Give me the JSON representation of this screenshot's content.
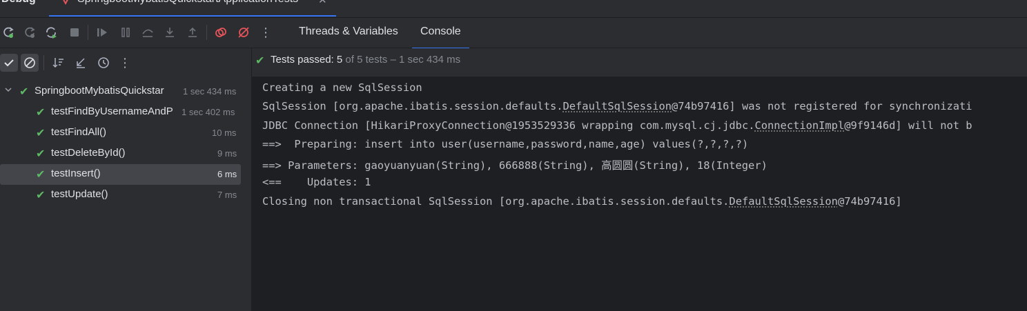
{
  "window": {
    "panel_title": "Debug",
    "run_tab_label": "SpringbootMybatisQuickstartApplicationTests",
    "run_tab_close": "✕"
  },
  "toolbar": {
    "tab_threads": "Threads & Variables",
    "tab_console": "Console",
    "more": "⋮"
  },
  "subbar": {
    "more": "⋮"
  },
  "status": {
    "label": "Tests passed:",
    "passed": "5",
    "rest": "of 5 tests – 1 sec 434 ms"
  },
  "tree": {
    "root": {
      "name": "SpringbootMybatisQuickstar",
      "time": "1 sec 434 ms"
    },
    "items": [
      {
        "name": "testFindByUsernameAndP",
        "time": "1 sec 402 ms"
      },
      {
        "name": "testFindAll()",
        "time": "10 ms"
      },
      {
        "name": "testDeleteById()",
        "time": "9 ms"
      },
      {
        "name": "testInsert()",
        "time": "6 ms"
      },
      {
        "name": "testUpdate()",
        "time": "7 ms"
      }
    ]
  },
  "console": {
    "l1": "Creating a new SqlSession",
    "l2a": "SqlSession [org.apache.ibatis.session.defaults.",
    "l2b": "DefaultSqlSession",
    "l2c": "@74b97416] was not registered for synchronizati",
    "l3a": "JDBC Connection [HikariProxyConnection@1953529336 wrapping com.mysql.cj.jdbc.",
    "l3b": "ConnectionImpl",
    "l3c": "@9f9146d] will not b",
    "l4": "==>  Preparing: insert into user(username,password,name,age) values(?,?,?,?)",
    "l5": "==> Parameters: gaoyuanyuan(String), 666888(String), 高圆圆(String), 18(Integer)",
    "l6": "<==    Updates: 1",
    "l7a": "Closing non transactional SqlSession [org.apache.ibatis.session.defaults.",
    "l7b": "DefaultSqlSession",
    "l7c": "@74b97416]"
  },
  "colors": {
    "accent": "#3574f0",
    "pass": "#5fb865",
    "stop": "#e5545b"
  }
}
